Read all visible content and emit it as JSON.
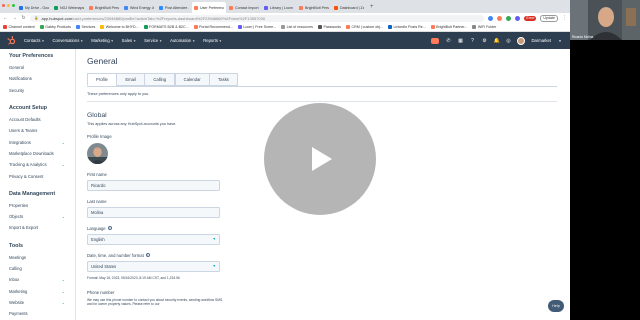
{
  "browser": {
    "tabs": [
      {
        "label": "My Drive - Google",
        "color": "#1a73e8",
        "active": false
      },
      {
        "label": "NGJ Webmaps in",
        "color": "#0f9d58",
        "active": false
      },
      {
        "label": "BrightBolt Personal",
        "color": "#ff7a59",
        "active": false
      },
      {
        "label": "Wind Energy Jump",
        "color": "#4285f4",
        "active": false
      },
      {
        "label": "Post Attendee - Zoom",
        "color": "#2d8cff",
        "active": false
      },
      {
        "label": "User Preferences | Hub",
        "color": "#ff7a59",
        "active": true
      },
      {
        "label": "Contact Import | Hu",
        "color": "#ff7a59",
        "active": false
      },
      {
        "label": "Library | Loom",
        "color": "#625df5",
        "active": false
      },
      {
        "label": "BrightBolt Personal",
        "color": "#ff7a59",
        "active": false
      },
      {
        "label": "Dashboard | Zapier",
        "color": "#ff4f00",
        "active": false
      }
    ],
    "new_tab": "+",
    "url_host": "app.hubspot.com",
    "url_path": "/user-preferences/23946860/profile?activeTab=%2Freports-dashboard%2F23946860%2Fview%2F13557030",
    "error_badge": "Error",
    "update_button": "Update",
    "bookmarks": [
      {
        "label": "Channel content",
        "color": "#ea4335"
      },
      {
        "label": "Gabby Products",
        "color": "#34a853"
      },
      {
        "label": "Services",
        "color": "#4285f4"
      },
      {
        "label": "Welcome to BHYD...",
        "color": "#fbbc05"
      },
      {
        "label": "FORMATS B2B & B2C...",
        "color": "#0f9d58"
      },
      {
        "label": "Portal Recommend...",
        "color": "#ff7a59"
      },
      {
        "label": "Loom | Free Scree...",
        "color": "#625df5"
      },
      {
        "label": "List of resources",
        "color": "#999999"
      },
      {
        "label": "Passwords",
        "color": "#555555"
      },
      {
        "label": "CRM | custom obj...",
        "color": "#ff7a59"
      },
      {
        "label": "LinkedIn Posts Re...",
        "color": "#0a66c2"
      },
      {
        "label": "BrightBolt Partner...",
        "color": "#ff7a59"
      },
      {
        "label": "WiFi Folder",
        "color": "#888888"
      }
    ]
  },
  "hubspot_nav": {
    "items": [
      "Contacts",
      "Conversations",
      "Marketing",
      "Sales",
      "Service",
      "Automation",
      "Reports"
    ],
    "account": "Darmarket"
  },
  "sidebar": {
    "sections": [
      {
        "title": "Your Preferences",
        "items": [
          {
            "label": "General",
            "expandable": false
          },
          {
            "label": "Notifications",
            "expandable": false
          },
          {
            "label": "Security",
            "expandable": false
          }
        ]
      },
      {
        "title": "Account Setup",
        "items": [
          {
            "label": "Account Defaults",
            "expandable": false
          },
          {
            "label": "Users & Teams",
            "expandable": false
          },
          {
            "label": "Integrations",
            "expandable": true
          },
          {
            "label": "Marketplace Downloads",
            "expandable": false
          },
          {
            "label": "Tracking & Analytics",
            "expandable": true
          },
          {
            "label": "Privacy & Consent",
            "expandable": false
          }
        ]
      },
      {
        "title": "Data Management",
        "items": [
          {
            "label": "Properties",
            "expandable": false
          },
          {
            "label": "Objects",
            "expandable": true
          },
          {
            "label": "Import & Export",
            "expandable": false
          }
        ]
      },
      {
        "title": "Tools",
        "items": [
          {
            "label": "Meetings",
            "expandable": false
          },
          {
            "label": "Calling",
            "expandable": false
          },
          {
            "label": "Inbox",
            "expandable": true
          },
          {
            "label": "Marketing",
            "expandable": true
          },
          {
            "label": "Website",
            "expandable": true
          },
          {
            "label": "Payments",
            "expandable": false
          }
        ]
      }
    ]
  },
  "main": {
    "title": "General",
    "tabs": [
      "Profile",
      "Email",
      "Calling",
      "Calendar",
      "Tasks"
    ],
    "active_tab": 0,
    "prefs_note": "These preferences only apply to you.",
    "global_heading": "Global",
    "global_desc": "This applies across any HubSpot accounts you have.",
    "profile_image_label": "Profile Image",
    "first_name_label": "First name",
    "first_name_value": "Ricardo",
    "last_name_label": "Last name",
    "last_name_value": "Molina",
    "language_label": "Language",
    "language_value": "English",
    "datetime_label": "Date, time, and number format",
    "datetime_value": "United States",
    "format_note": "Format: May 16, 2023, 05/16/2023, 8:19 AM CST, and 1,234.56",
    "phone_label": "Phone number",
    "phone_desc": "We may use this phone number to contact you about security events, sending workflow SMS, and for owner property values. Please refer to our"
  },
  "help_button": "Help",
  "webcam": {
    "name": "Ricardo Molina"
  },
  "colors": {
    "accent": "#ff7a59",
    "nav": "#2d3e50",
    "link": "#00a4bd",
    "text": "#33475b"
  }
}
